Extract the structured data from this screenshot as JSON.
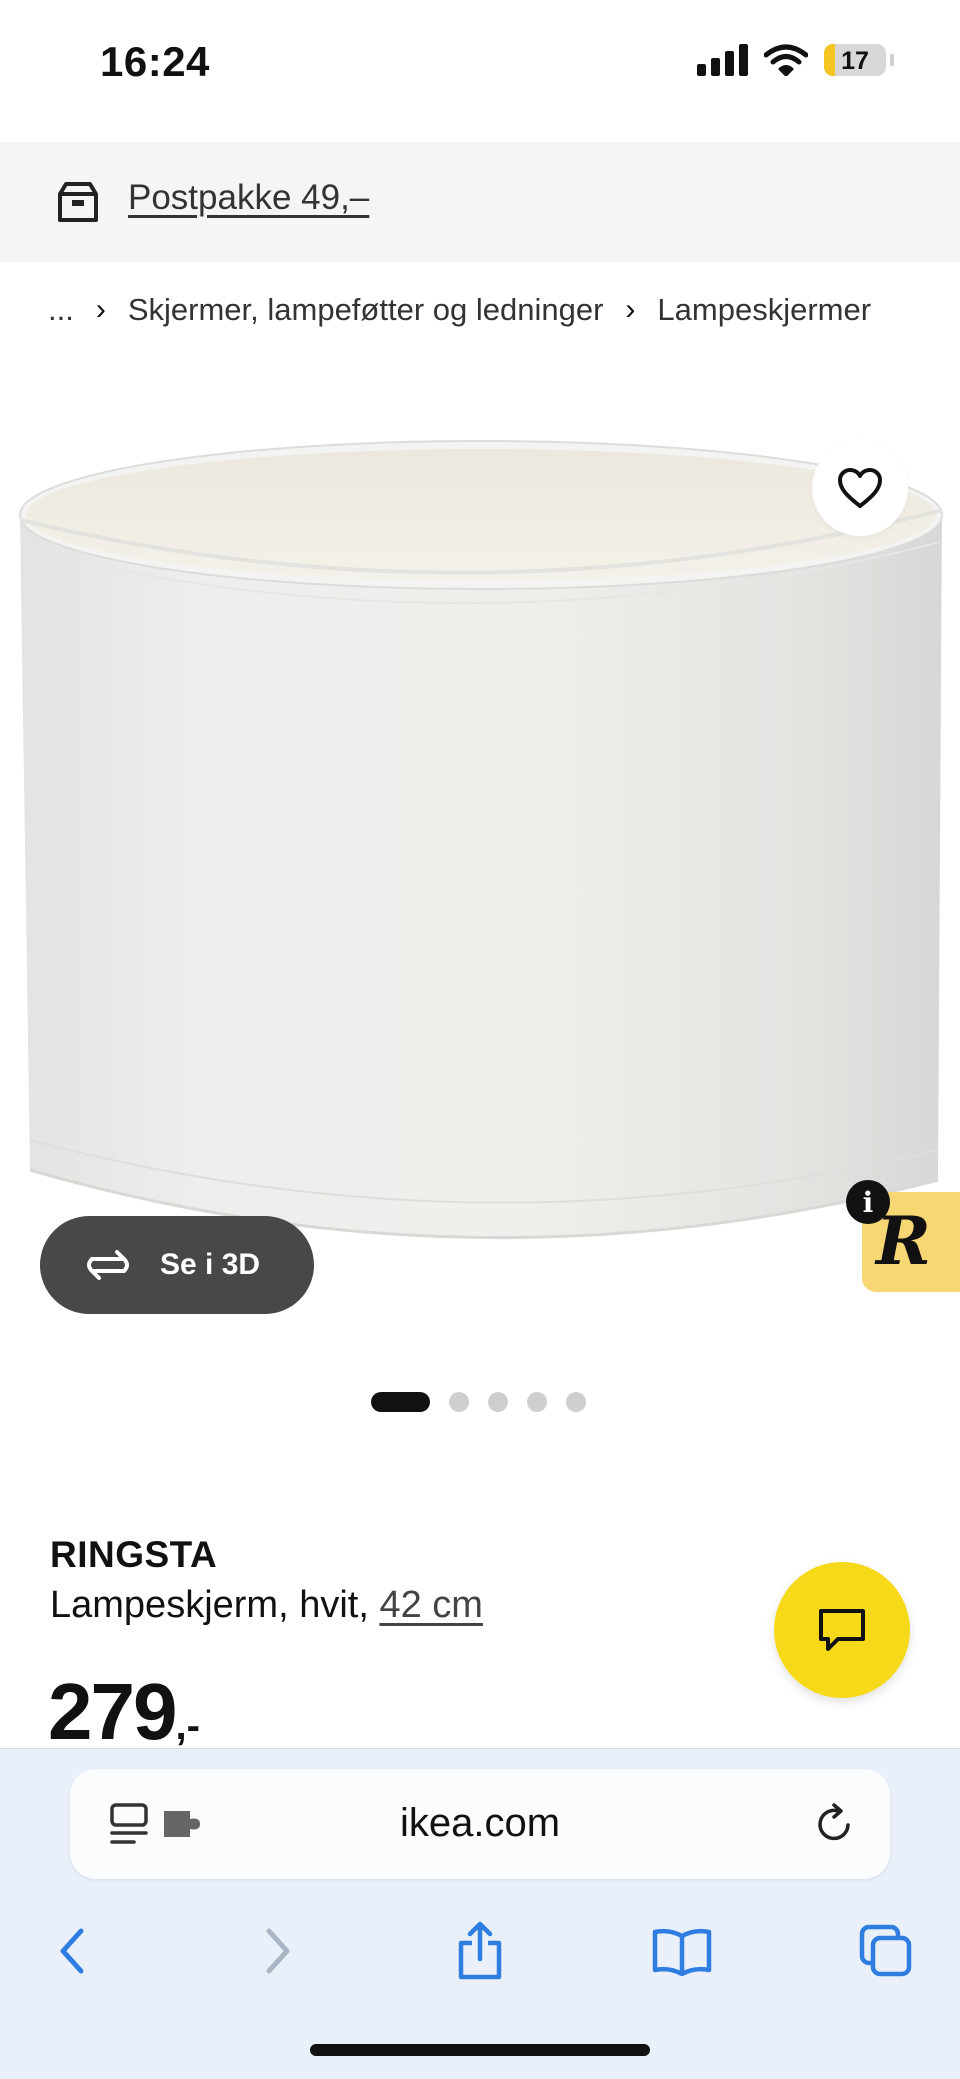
{
  "status_bar": {
    "time": "16:24",
    "battery_level": "17",
    "battery_fraction": 0.17,
    "icons": [
      "cellular-signal-icon",
      "wifi-icon",
      "battery-icon"
    ]
  },
  "delivery": {
    "icon": "delivery-box-icon",
    "label": "Postpakke 49,–"
  },
  "breadcrumb": {
    "items": [
      "...",
      "Skjermer, lampeføtter og ledninger",
      "Lampeskjermer"
    ],
    "separator_icon": "chevron-right-icon"
  },
  "gallery": {
    "favorite_icon": "heart-icon",
    "view3d_icon": "rotate-3d-icon",
    "view3d_label": "Se i 3D",
    "widget_letter": "R",
    "widget_info": "i",
    "slide_count": 5,
    "active_slide": 1
  },
  "product": {
    "name": "RINGSTA",
    "description": "Lampeskjerm, hvit,",
    "size": "42 cm",
    "price": "279",
    "price_suffix": ",-"
  },
  "chat": {
    "icon": "chat-bubble-icon"
  },
  "browser": {
    "url": "ikea.com",
    "icons": [
      "reader-icon",
      "extension-icon",
      "reload-icon",
      "back-icon",
      "forward-icon",
      "share-icon",
      "bookmarks-icon",
      "tabs-icon"
    ]
  },
  "colors": {
    "ikea_yellow": "#f6d919",
    "browser_blue": "#2f7de1",
    "text_dark": "#111111"
  }
}
